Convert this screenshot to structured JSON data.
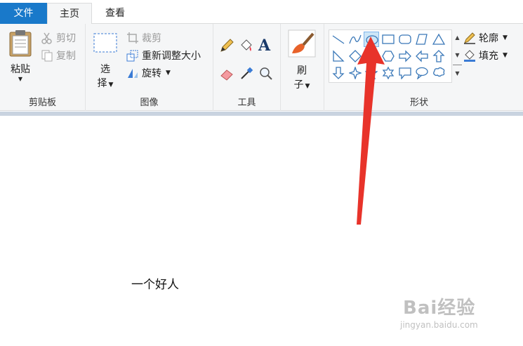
{
  "tabs": {
    "file": "文件",
    "home": "主页",
    "view": "查看"
  },
  "clipboard": {
    "paste": "粘贴",
    "cut": "剪切",
    "copy": "复制",
    "label": "剪贴板"
  },
  "image": {
    "select_top": "选",
    "select_bottom": "择",
    "crop": "裁剪",
    "resize": "重新调整大小",
    "rotate": "旋转",
    "label": "图像"
  },
  "tools": {
    "label": "工具",
    "text_glyph": "A"
  },
  "brushes": {
    "top": "刷",
    "bottom": "子"
  },
  "shapes": {
    "label": "形状",
    "outline": "轮廓",
    "fill": "填充"
  },
  "canvas": {
    "text": "一个好人"
  },
  "watermark": {
    "brand": "Bai经验",
    "url": "jingyan.baidu.com"
  },
  "colors": {
    "accent": "#1979ca",
    "annotation_arrow": "#e8332a",
    "selected_shape": "#cde6f7"
  },
  "icons": [
    "clipboard-icon",
    "scissors-icon",
    "copy-icon",
    "selection-rect-icon",
    "crop-icon",
    "resize-icon",
    "rotate-icon",
    "pencil-icon",
    "fill-bucket-icon",
    "text-icon",
    "eraser-icon",
    "color-picker-icon",
    "magnifier-icon",
    "brush-icon",
    "outline-icon",
    "fill-icon"
  ]
}
